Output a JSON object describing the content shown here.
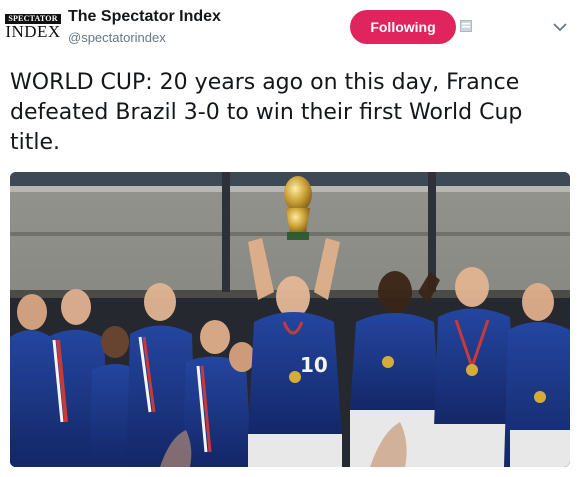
{
  "account": {
    "avatar_text_top": "SPECTATOR",
    "avatar_text_bottom": "INDEX",
    "display_name": "The Spectator Index",
    "handle": "@spectatorindex"
  },
  "follow_button": {
    "label": "Following",
    "color": "#e0245e"
  },
  "icons": {
    "extra": "bookmark-icon",
    "menu": "chevron-down-icon"
  },
  "tweet": {
    "text": "WORLD CUP: 20 years ago on this day, France defeated Brazil 3-0 to win their first World Cup title."
  },
  "photo": {
    "subject": "France team celebrating with World Cup trophy",
    "jersey_color": "#1b3a8c"
  }
}
